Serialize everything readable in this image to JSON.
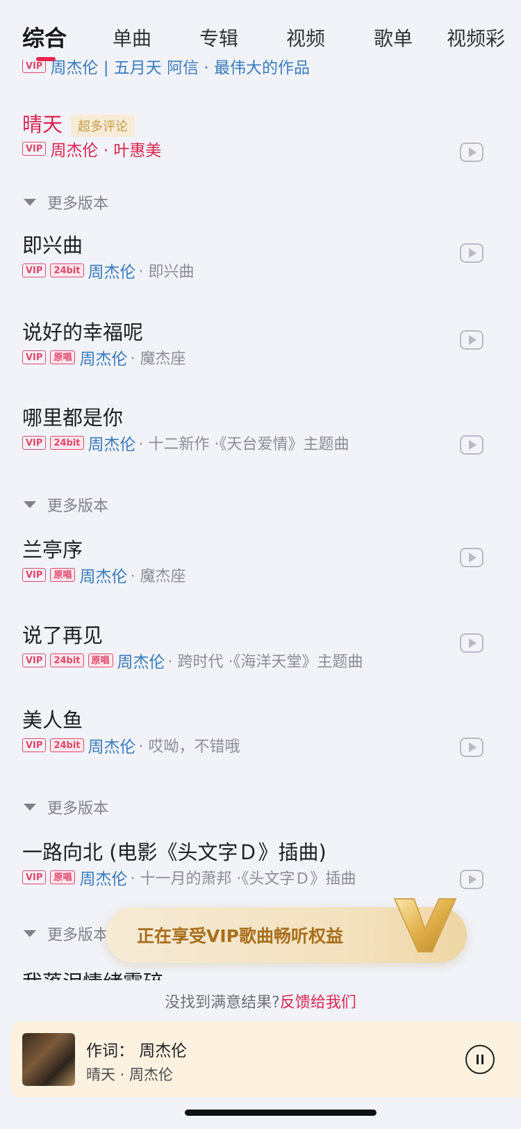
{
  "tabs": [
    "综合",
    "单曲",
    "专辑",
    "视频",
    "歌单",
    "视频彩"
  ],
  "cut_row": {
    "badge": "VIP",
    "text": "周杰伦 | 五月天 阿信 · 最伟大的作品"
  },
  "songs": [
    {
      "title": "晴天",
      "tag": "超多评论",
      "badges": [
        "VIP"
      ],
      "artist": "周杰伦 · 叶惠美",
      "extra": ""
    },
    {
      "title": "即兴曲",
      "badges": [
        "VIP",
        "24bit"
      ],
      "artist": "周杰伦",
      "extra": "· 即兴曲"
    },
    {
      "title": "说好的幸福呢",
      "badges": [
        "VIP",
        "原唱"
      ],
      "artist": "周杰伦",
      "extra": "· 魔杰座"
    },
    {
      "title": "哪里都是你",
      "badges": [
        "VIP",
        "24bit"
      ],
      "artist": "周杰伦",
      "extra": "· 十二新作 ·《天台爱情》主题曲"
    },
    {
      "title": "兰亭序",
      "badges": [
        "VIP",
        "原唱"
      ],
      "artist": "周杰伦",
      "extra": "· 魔杰座"
    },
    {
      "title": "说了再见",
      "badges": [
        "VIP",
        "24bit",
        "原唱"
      ],
      "artist": "周杰伦",
      "extra": "· 跨时代 ·《海洋天堂》主题曲"
    },
    {
      "title": "美人鱼",
      "badges": [
        "VIP",
        "24bit"
      ],
      "artist": "周杰伦",
      "extra": "· 哎呦，不错哦"
    },
    {
      "title": "一路向北 (电影《头文字Ｄ》插曲)",
      "badges": [
        "VIP",
        "原唱"
      ],
      "artist": "周杰伦",
      "extra": "· 十一月的萧邦 ·《头文字Ｄ》插曲"
    },
    {
      "title": "我落泪情绪零碎",
      "badges": [],
      "artist": "",
      "extra": ""
    }
  ],
  "more_versions": "更多版本",
  "vip_banner": "正在享受VIP歌曲畅听权益",
  "feedback": {
    "prefix": "没找到满意结果?",
    "link": "反馈给我们"
  },
  "player": {
    "line1": "作词：  周杰伦",
    "line2": "晴天 · 周杰伦"
  },
  "colors": {
    "accent": "#dd2450",
    "link": "#3a7bbd",
    "background": "#f1f3f8"
  }
}
